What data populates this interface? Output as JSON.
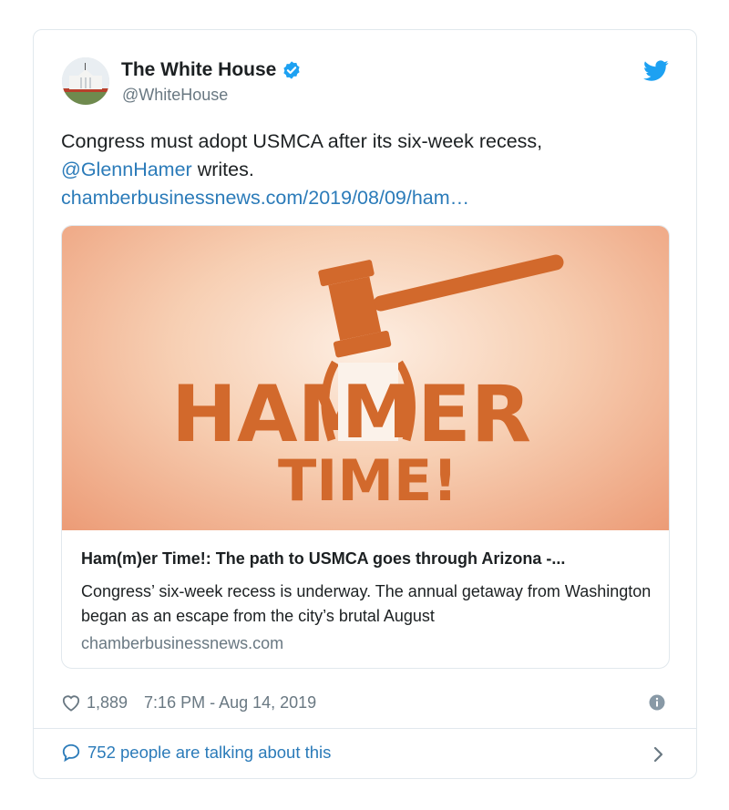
{
  "author": {
    "name": "The White House",
    "handle": "@WhiteHouse"
  },
  "tweet": {
    "text_line1": "Congress must adopt USMCA after its six-week recess,",
    "mention": "@GlennHamer",
    "text_after_mention": " writes.",
    "link": "chamberbusinessnews.com/2019/08/09/ham…"
  },
  "card": {
    "image_text_line1_part1": "HAM",
    "image_text_line1_m": "M",
    "image_text_line1_part2": "ER",
    "image_text_line2": "TIME!",
    "title": "Ham(m)er Time!: The path to USMCA goes through Arizona -...",
    "description": "Congress’ six-week recess is underway. The annual getaway from Washington began as an escape from the city’s brutal August",
    "domain": "chamberbusinessnews.com"
  },
  "meta": {
    "likes": "1,889",
    "timestamp": "7:16 PM - Aug 14, 2019"
  },
  "footer": {
    "talking": "752 people are talking about this"
  },
  "colors": {
    "link_blue": "#2b7bb9",
    "twitter_blue": "#1da1f2",
    "gavel_orange": "#d2692c",
    "muted_gray": "#697882"
  },
  "icons": [
    "verified-badge-icon",
    "twitter-bird-icon",
    "heart-icon",
    "info-icon",
    "speech-bubble-icon",
    "chevron-right-icon"
  ]
}
